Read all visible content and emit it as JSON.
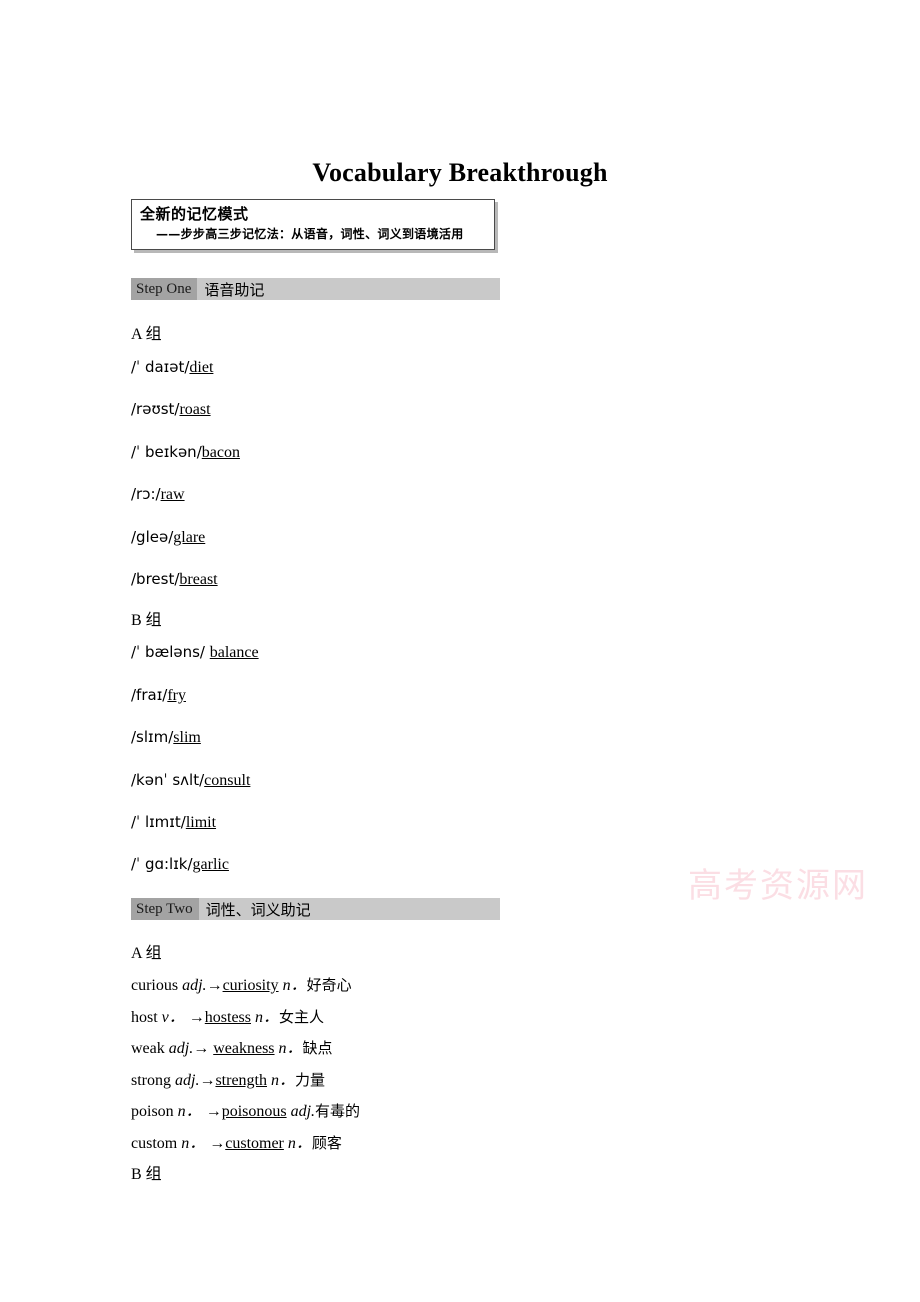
{
  "document": {
    "title": "Vocabulary Breakthrough",
    "watermark": "高考资源网"
  },
  "callout": {
    "heading": "全新的记忆模式",
    "subheading": "——步步高三步记忆法：从语音，词性、词义到语境活用"
  },
  "steps": [
    {
      "tag": "Step One",
      "label": "语音助记",
      "groups": [
        {
          "name": "A 组",
          "entries": [
            {
              "phonetic": "/ˈ daɪət/",
              "word": "diet"
            },
            {
              "phonetic": "/rəʊst/",
              "word": "roast"
            },
            {
              "phonetic": "/ˈ beɪkən/",
              "word": "bacon"
            },
            {
              "phonetic": "/rɔ:/",
              "word": "raw"
            },
            {
              "phonetic": "/gleə/",
              "word": "glare"
            },
            {
              "phonetic": "/brest/",
              "word": "breast"
            }
          ]
        },
        {
          "name": "B 组",
          "entries": [
            {
              "phonetic": "/ˈ bæləns/ ",
              "word": "balance"
            },
            {
              "phonetic": "/fraɪ/",
              "word": "fry"
            },
            {
              "phonetic": "/slɪm/",
              "word": "slim"
            },
            {
              "phonetic": "/kənˈ sʌlt/",
              "word": "consult"
            },
            {
              "phonetic": "/ˈ lɪmɪt/",
              "word": "limit"
            },
            {
              "phonetic": "/ˈ gɑ:lɪk/",
              "word": "garlic"
            }
          ]
        }
      ]
    },
    {
      "tag": "Step Two",
      "label": "词性、词义助记",
      "groups": [
        {
          "name": "A 组",
          "entries": [
            {
              "base": "curious ",
              "base_pos": "adj.",
              "arrow": "→",
              "derived": "curiosity",
              "derived_pos": " n．",
              "meaning": "好奇心"
            },
            {
              "base": "host ",
              "base_pos": "v．",
              "arrow": " →",
              "derived": "hostess",
              "derived_pos": " n．",
              "meaning": "女主人"
            },
            {
              "base": "weak ",
              "base_pos": "adj.",
              "arrow": "→ ",
              "derived": "weakness",
              "derived_pos": " n．",
              "meaning": "缺点"
            },
            {
              "base": "strong ",
              "base_pos": "adj.",
              "arrow": "→",
              "derived": "strength",
              "derived_pos": " n．",
              "meaning": "力量"
            },
            {
              "base": "poison ",
              "base_pos": "n．",
              "arrow": " →",
              "derived": "poisonous",
              "derived_pos": " adj.",
              "meaning": "有毒的"
            },
            {
              "base": "custom ",
              "base_pos": "n．",
              "arrow": " →",
              "derived": "customer",
              "derived_pos": " n．",
              "meaning": "顾客"
            }
          ]
        },
        {
          "name": "B 组",
          "entries": []
        }
      ]
    }
  ]
}
